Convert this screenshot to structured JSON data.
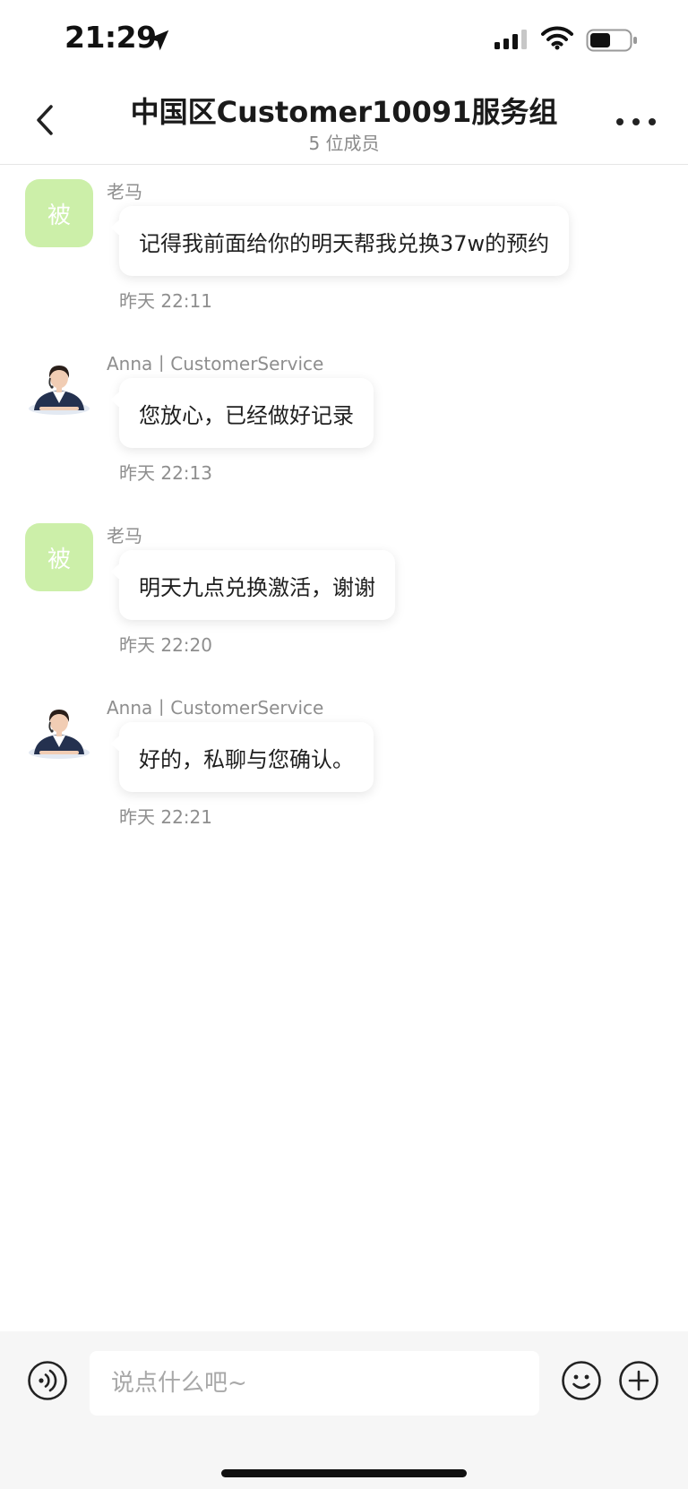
{
  "status_bar": {
    "time": "21:29"
  },
  "header": {
    "title": "中国区Customer10091服务组",
    "subtitle": "5 位成员"
  },
  "messages": [
    {
      "sender": "老马",
      "avatar_text": "被",
      "avatar_type": "text",
      "text": "记得我前面给你的明天帮我兑换37w的预约",
      "time": "昨天 22:11"
    },
    {
      "sender": "Anna丨CustomerService",
      "avatar_type": "photo",
      "text": "您放心，已经做好记录",
      "time": "昨天 22:13"
    },
    {
      "sender": "老马",
      "avatar_text": "被",
      "avatar_type": "text",
      "text": "明天九点兑换激活，谢谢",
      "time": "昨天 22:20"
    },
    {
      "sender": "Anna丨CustomerService",
      "avatar_type": "photo",
      "text": "好的，私聊与您确认。",
      "time": "昨天 22:21"
    }
  ],
  "input_bar": {
    "placeholder": "说点什么吧~",
    "value": ""
  },
  "colors": {
    "text_avatar_bg": "#ccefa9",
    "input_bar_bg": "#f6f6f6",
    "meta_text": "#8e8e8e"
  }
}
